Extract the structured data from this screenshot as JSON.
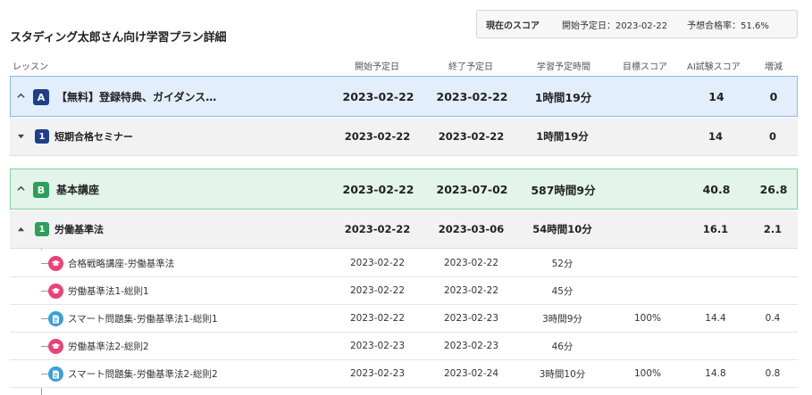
{
  "page": {
    "title": "スタディング太郎さん向け学習プラン詳細"
  },
  "score_box": {
    "label": "現在のスコア",
    "start": "開始予定日：2023-02-22",
    "pass_rate": "予想合格率：51.6%"
  },
  "columns": {
    "lesson": "レッスン",
    "start": "開始予定日",
    "end": "終了予定日",
    "time": "学習予定時間",
    "target": "目標スコア",
    "ai": "AI試験スコア",
    "diff": "増減"
  },
  "sections": [
    {
      "badge": "A",
      "title": "【無料】登録特典、ガイダンス…",
      "start": "2023-02-22",
      "end": "2023-02-22",
      "time": "1時間19分",
      "target": "",
      "ai": "14",
      "diff": "0",
      "subsection": {
        "badge": "1",
        "title": "短期合格セミナー",
        "start": "2023-02-22",
        "end": "2023-02-22",
        "time": "1時間19分",
        "target": "",
        "ai": "14",
        "diff": "0"
      }
    },
    {
      "badge": "B",
      "title": "基本講座",
      "start": "2023-02-22",
      "end": "2023-07-02",
      "time": "587時間9分",
      "target": "",
      "ai": "40.8",
      "diff": "26.8",
      "subsection": {
        "badge": "1",
        "title": "労働基準法",
        "start": "2023-02-22",
        "end": "2023-03-06",
        "time": "54時間10分",
        "target": "",
        "ai": "16.1",
        "diff": "2.1"
      }
    }
  ],
  "items": [
    {
      "icon": "graduation-cap-icon",
      "title": "合格戦略講座-労働基準法",
      "start": "2023-02-22",
      "end": "2023-02-22",
      "time": "52分",
      "target": "",
      "ai": "",
      "diff": ""
    },
    {
      "icon": "graduation-cap-icon",
      "title": "労働基準法1-総則1",
      "start": "2023-02-22",
      "end": "2023-02-22",
      "time": "45分",
      "target": "",
      "ai": "",
      "diff": ""
    },
    {
      "icon": "document-icon",
      "title": "スマート問題集-労働基準法1-総則1",
      "start": "2023-02-22",
      "end": "2023-02-23",
      "time": "3時間9分",
      "target": "100%",
      "ai": "14.4",
      "diff": "0.4"
    },
    {
      "icon": "graduation-cap-icon",
      "title": "労働基準法2-総則2",
      "start": "2023-02-23",
      "end": "2023-02-23",
      "time": "46分",
      "target": "",
      "ai": "",
      "diff": ""
    },
    {
      "icon": "document-icon",
      "title": "スマート問題集-労働基準法2-総則2",
      "start": "2023-02-23",
      "end": "2023-02-24",
      "time": "3時間10分",
      "target": "100%",
      "ai": "14.8",
      "diff": "0.8"
    }
  ]
}
